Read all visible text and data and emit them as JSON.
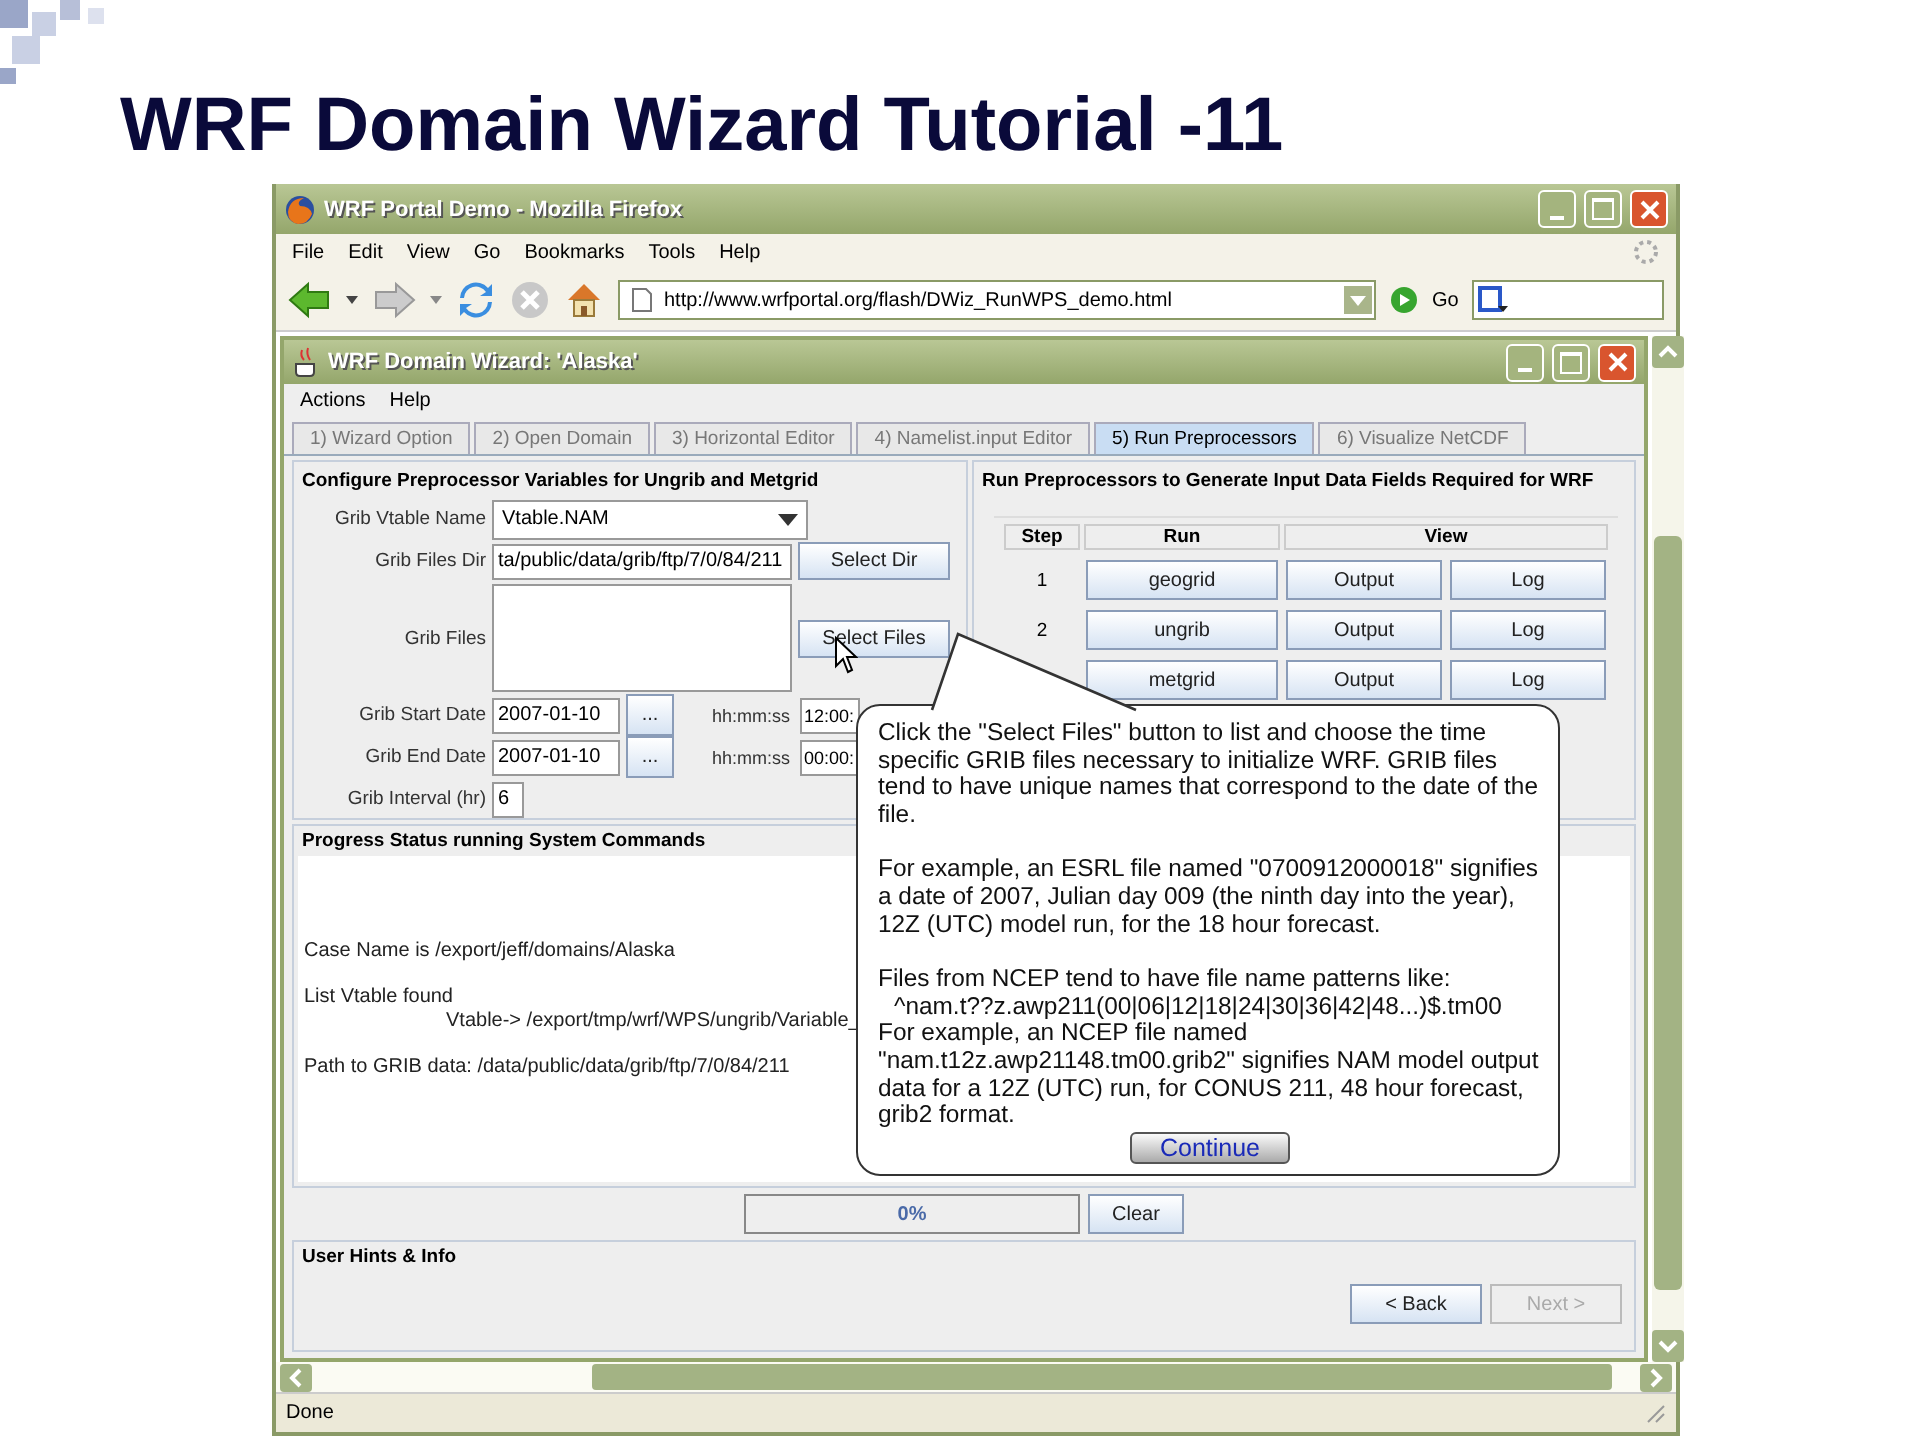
{
  "slide": {
    "title": "WRF Domain Wizard Tutorial -11"
  },
  "browser": {
    "title": "WRF Portal Demo - Mozilla Firefox",
    "menu": [
      "File",
      "Edit",
      "View",
      "Go",
      "Bookmarks",
      "Tools",
      "Help"
    ],
    "address": "http://www.wrfportal.org/flash/DWiz_RunWPS_demo.html",
    "go": "Go",
    "status": "Done"
  },
  "app": {
    "title": "WRF Domain Wizard: 'Alaska'",
    "menu": [
      "Actions",
      "Help"
    ],
    "tabs": [
      {
        "label": "1) Wizard Option",
        "selected": false
      },
      {
        "label": "2) Open Domain",
        "selected": false
      },
      {
        "label": "3) Horizontal Editor",
        "selected": false
      },
      {
        "label": "4) Namelist.input Editor",
        "selected": false
      },
      {
        "label": "5) Run Preprocessors",
        "selected": true
      },
      {
        "label": "6) Visualize NetCDF",
        "selected": false
      }
    ],
    "config": {
      "title": "Configure Preprocessor Variables for Ungrib and Metgrid",
      "vtable_label": "Grib Vtable Name",
      "vtable": "Vtable.NAM",
      "dir_label": "Grib Files Dir",
      "dir": "ta/public/data/grib/ftp/7/0/84/211",
      "select_dir": "Select Dir",
      "files_label": "Grib Files",
      "select_files": "Select Files",
      "start_label": "Grib Start Date",
      "start": "2007-01-10",
      "start_button": "...",
      "start_time_label": "hh:mm:ss",
      "start_time": "12:00:",
      "end_label": "Grib End Date",
      "end": "2007-01-10",
      "end_button": "...",
      "end_time_label": "hh:mm:ss",
      "end_time": "00:00:",
      "interval_label": "Grib Interval (hr)",
      "interval": "6"
    },
    "run": {
      "title": "Run Preprocessors to Generate Input Data Fields Required for WRF",
      "columns": [
        "Step",
        "Run",
        "View"
      ],
      "steps": [
        {
          "step": "1",
          "run": "geogrid",
          "output": "Output",
          "log": "Log"
        },
        {
          "step": "2",
          "run": "ungrib",
          "output": "Output",
          "log": "Log"
        },
        {
          "run": "metgrid",
          "output": "Output",
          "log": "Log"
        }
      ]
    },
    "progress": {
      "title": "Progress Status running System Commands",
      "lines": [
        {
          "kind": "line",
          "text": "Case Name is /export/jeff/domains/Alaska"
        },
        {
          "kind": "line",
          "text": "List Vtable found"
        },
        {
          "kind": "sub",
          "text": "Vtable-> /export/tmp/wrf/WPS/ungrib/Variable_"
        },
        {
          "kind": "line",
          "text": "Path to GRIB data: /data/public/data/grib/ftp/7/0/84/211"
        }
      ],
      "bar": {
        "text": "0%",
        "level": 0
      },
      "clear": "Clear"
    },
    "hints": {
      "title": "User Hints & Info",
      "back": {
        "label": "< Back",
        "disabled": false
      },
      "next": {
        "label": "Next >",
        "disabled": true
      }
    }
  },
  "callout": {
    "blocks": [
      {
        "kind": "para",
        "text": "Click the \"Select Files\" button to list and choose the time specific GRIB files necessary to initialize WRF. GRIB files tend to have unique names that correspond to the date of the file."
      },
      {
        "kind": "para",
        "text": "For example, an ESRL file named \"0700912000018\" signifies a date of 2007, Julian day 009 (the ninth day into the year), 12Z (UTC) model run, for the 18 hour forecast."
      },
      {
        "kind": "para",
        "text": "Files from NCEP tend to have file name patterns like:"
      },
      {
        "kind": "code",
        "text": "^nam.t??z.awp211(00|06|12|18|24|30|36|42|48...)$.tm00"
      },
      {
        "kind": "line",
        "text": "For example, an NCEP file named \"nam.t12z.awp21148.tm00.grib2\" signifies NAM model output data for a 12Z (UTC) run, for CONUS 211, 48 hour forecast, grib2 format."
      }
    ],
    "button": "Continue"
  }
}
